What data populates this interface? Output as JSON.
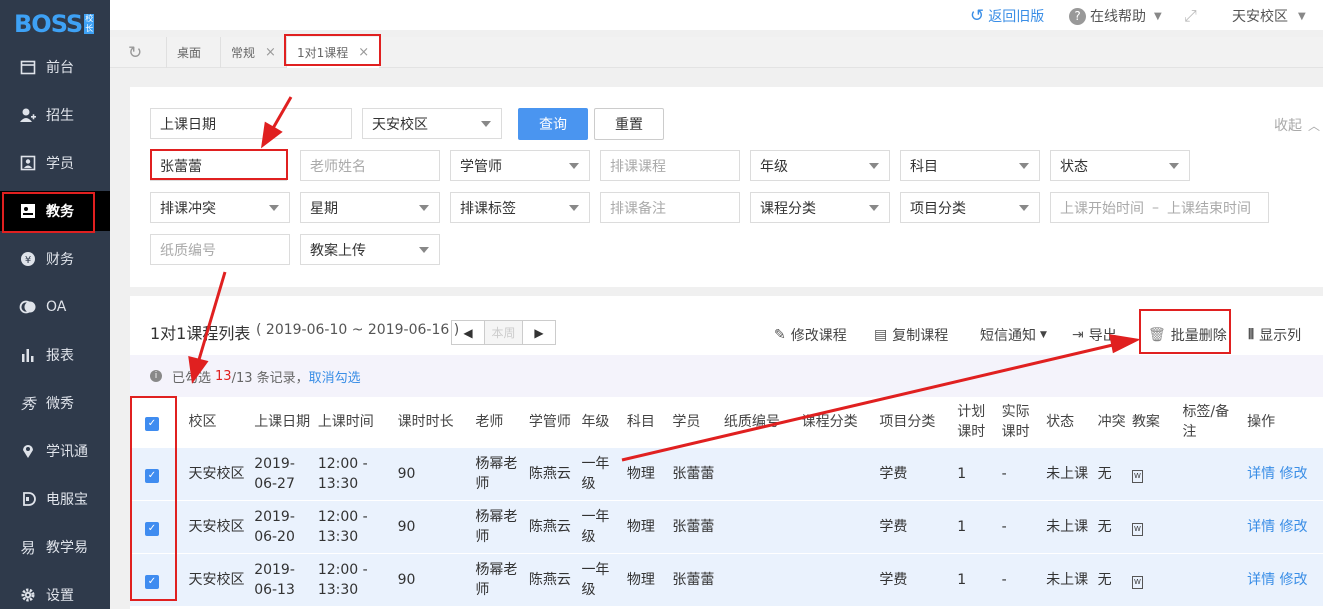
{
  "brand": {
    "logo_text": "BOSS",
    "logo_tag": "校长"
  },
  "sidebar": {
    "items": [
      {
        "label": "前台",
        "icon": "calendar-icon"
      },
      {
        "label": "招生",
        "icon": "add-user-icon"
      },
      {
        "label": "学员",
        "icon": "id-card-icon"
      },
      {
        "label": "教务",
        "icon": "teaching-icon"
      },
      {
        "label": "财务",
        "icon": "yen-icon"
      },
      {
        "label": "OA",
        "icon": "chat-icon"
      },
      {
        "label": "报表",
        "icon": "bar-chart-icon"
      },
      {
        "label": "微秀",
        "icon": "show-icon"
      },
      {
        "label": "学讯通",
        "icon": "location-icon"
      },
      {
        "label": "电服宝",
        "icon": "service-icon"
      },
      {
        "label": "教学易",
        "icon": "teach-easy-icon"
      },
      {
        "label": "设置",
        "icon": "gear-icon"
      }
    ]
  },
  "topbar": {
    "back_old": "返回旧版",
    "help": "在线帮助",
    "campus": "天安校区"
  },
  "tabs": [
    {
      "label": "桌面"
    },
    {
      "label": "常规"
    },
    {
      "label": "1对1课程"
    }
  ],
  "filters": {
    "date": "上课日期",
    "campus": "天安校区",
    "query_btn": "查询",
    "reset_btn": "重置",
    "collapse": "收起",
    "student": "张蕾蕾",
    "teacher_ph": "老师姓名",
    "manager": "学管师",
    "course_ph": "排课课程",
    "grade": "年级",
    "subject": "科目",
    "status": "状态",
    "conflict": "排课冲突",
    "weekday": "星期",
    "tag": "排课标签",
    "remark_ph": "排课备注",
    "course_cat": "课程分类",
    "project_cat": "项目分类",
    "start_time_ph": "上课开始时间",
    "dash": "–",
    "end_time_ph": "上课结束时间",
    "paper_ph": "纸质编号",
    "lesson_plan": "教案上传"
  },
  "list": {
    "title": "1对1课程列表",
    "range": "( 2019-06-10 ~ 2019-06-16 )",
    "prev": "◀",
    "this_week": "本周",
    "next": "▶",
    "tools": {
      "edit": "修改课程",
      "copy": "复制课程",
      "sms": "短信通知",
      "export": "导出",
      "batch_delete": "批量删除",
      "columns": "显示列"
    },
    "notice_prefix": "已勾选",
    "selected": "13",
    "notice_total": "/13 条记录，",
    "cancel_select": "取消勾选"
  },
  "table": {
    "headers": [
      "校区",
      "上课日期",
      "上课时间",
      "课时时长",
      "老师",
      "学管师",
      "年级",
      "科目",
      "学员",
      "纸质编号",
      "课程分类",
      "项目分类",
      "计划课时",
      "实际课时",
      "状态",
      "冲突",
      "教案",
      "标签/备注",
      "操作"
    ],
    "rows": [
      {
        "campus": "天安校区",
        "date": "2019-06-27",
        "time": "12:00 - 13:30",
        "duration": "90",
        "teacher": "杨幂老师",
        "manager": "陈燕云",
        "grade": "一年级",
        "subject": "物理",
        "student": "张蕾蕾",
        "paper": "",
        "course_cat": "",
        "project_cat": "学费",
        "planned": "1",
        "actual": "-",
        "status": "未上课",
        "conflict": "无",
        "detail": "详情",
        "edit": "修改"
      },
      {
        "campus": "天安校区",
        "date": "2019-06-20",
        "time": "12:00 - 13:30",
        "duration": "90",
        "teacher": "杨幂老师",
        "manager": "陈燕云",
        "grade": "一年级",
        "subject": "物理",
        "student": "张蕾蕾",
        "paper": "",
        "course_cat": "",
        "project_cat": "学费",
        "planned": "1",
        "actual": "-",
        "status": "未上课",
        "conflict": "无",
        "detail": "详情",
        "edit": "修改"
      },
      {
        "campus": "天安校区",
        "date": "2019-06-13",
        "time": "12:00 - 13:30",
        "duration": "90",
        "teacher": "杨幂老师",
        "manager": "陈燕云",
        "grade": "一年级",
        "subject": "物理",
        "student": "张蕾蕾",
        "paper": "",
        "course_cat": "",
        "project_cat": "学费",
        "planned": "1",
        "actual": "-",
        "status": "未上课",
        "conflict": "无",
        "detail": "详情",
        "edit": "修改"
      }
    ]
  },
  "colors": {
    "sidebar_bg": "#2f3a4b",
    "primary": "#4a95f0",
    "highlight": "#e02020",
    "link": "#3a8ee6",
    "row_bg": "#eaf2fd"
  }
}
